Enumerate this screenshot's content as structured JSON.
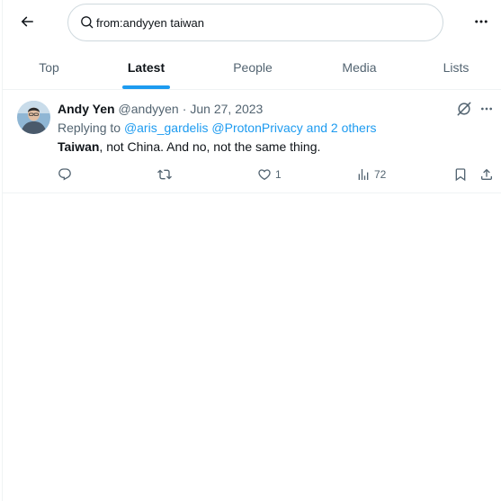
{
  "search": {
    "query": "from:andyyen taiwan"
  },
  "tabs": [
    {
      "label": "Top"
    },
    {
      "label": "Latest"
    },
    {
      "label": "People"
    },
    {
      "label": "Media"
    },
    {
      "label": "Lists"
    }
  ],
  "active_tab": "Latest",
  "tweet": {
    "display_name": "Andy Yen",
    "handle": "@andyyen",
    "separator": "·",
    "date": "Jun 27, 2023",
    "replying_prefix": "Replying to",
    "reply_to_1": "@aris_gardelis",
    "reply_to_2": "@ProtonPrivacy",
    "reply_to_others": "and 2 others",
    "text_bold": "Taiwan",
    "text_rest": ", not China. And no, not the same thing.",
    "likes": "1",
    "views": "72"
  },
  "icons": {
    "back": "back-arrow-icon",
    "search": "search-icon",
    "more": "more-icon",
    "grok": "grok-icon",
    "reply": "reply-icon",
    "retweet": "retweet-icon",
    "like": "like-icon",
    "views": "views-icon",
    "bookmark": "bookmark-icon",
    "share": "share-icon"
  },
  "colors": {
    "accent": "#1d9bf0",
    "text": "#0f1419",
    "secondary": "#536471"
  }
}
